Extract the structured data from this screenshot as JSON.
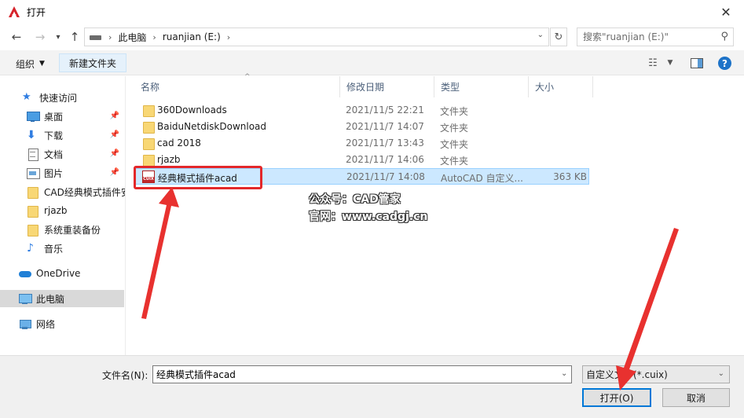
{
  "window": {
    "title": "打开",
    "close_glyph": "✕"
  },
  "address": {
    "crumbs": [
      "此电脑",
      "ruanjian (E:)"
    ],
    "search_placeholder": "搜索\"ruanjian (E:)\""
  },
  "toolbar": {
    "organize_label": "组织",
    "new_folder_label": "新建文件夹",
    "help_label": "?"
  },
  "sidebar": {
    "items": [
      {
        "label": "快速访问",
        "icon": "star-icon",
        "pinned": false
      },
      {
        "label": "桌面",
        "icon": "desktop-icon",
        "pinned": true
      },
      {
        "label": "下载",
        "icon": "download-icon",
        "pinned": true
      },
      {
        "label": "文档",
        "icon": "document-icon",
        "pinned": true
      },
      {
        "label": "图片",
        "icon": "picture-icon",
        "pinned": true
      },
      {
        "label": "CAD经典模式插件安",
        "icon": "folder-icon",
        "pinned": false
      },
      {
        "label": "rjazb",
        "icon": "folder-icon",
        "pinned": false
      },
      {
        "label": "系统重装备份",
        "icon": "folder-icon",
        "pinned": false
      },
      {
        "label": "音乐",
        "icon": "music-icon",
        "pinned": false
      },
      {
        "label": "OneDrive",
        "icon": "cloud-icon",
        "pinned": false
      },
      {
        "label": "此电脑",
        "icon": "computer-icon",
        "pinned": false,
        "selected": true
      },
      {
        "label": "网络",
        "icon": "network-icon",
        "pinned": false
      }
    ]
  },
  "columns": {
    "name": "名称",
    "date": "修改日期",
    "type": "类型",
    "size": "大小"
  },
  "files": [
    {
      "name": "360Downloads",
      "date": "2021/11/5 22:21",
      "type": "文件夹",
      "size": "",
      "icon": "folder-icon"
    },
    {
      "name": "BaiduNetdiskDownload",
      "date": "2021/11/7 14:07",
      "type": "文件夹",
      "size": "",
      "icon": "folder-icon"
    },
    {
      "name": "cad 2018",
      "date": "2021/11/7 13:43",
      "type": "文件夹",
      "size": "",
      "icon": "folder-icon"
    },
    {
      "name": "rjazb",
      "date": "2021/11/7 14:06",
      "type": "文件夹",
      "size": "",
      "icon": "folder-icon"
    },
    {
      "name": "经典模式插件acad",
      "date": "2021/11/7 14:08",
      "type": "AutoCAD 自定义...",
      "size": "363 KB",
      "icon": "cuix-file-icon",
      "selected": true
    }
  ],
  "watermark": {
    "line1": "公众号：CAD管家",
    "line2": "官网：www.cadgj.cn"
  },
  "footer": {
    "filename_label": "文件名(N):",
    "filename_value": "经典模式插件acad",
    "filetype_value": "自定义文件(*.cuix)",
    "open_label": "打开(O)",
    "cancel_label": "取消"
  },
  "colors": {
    "accent": "#0078d7",
    "highlight": "#e3282a",
    "selection": "#cce8ff"
  }
}
